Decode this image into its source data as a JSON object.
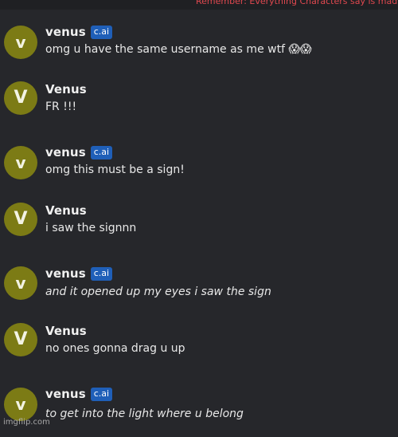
{
  "banner": {
    "text": "Remember: Everything Characters say is mad"
  },
  "messages": [
    {
      "avatar": "v",
      "name": "venus",
      "badge": "c.ai",
      "text": "omg u have the same username as me wtf 😱😱",
      "italic": false
    },
    {
      "avatar": "V",
      "name": "Venus",
      "badge": "",
      "text": "FR !!!",
      "italic": false
    },
    {
      "avatar": "v",
      "name": "venus",
      "badge": "c.ai",
      "text": "omg this must be a sign!",
      "italic": false
    },
    {
      "avatar": "V",
      "name": "Venus",
      "badge": "",
      "text": "i saw the signnn",
      "italic": false
    },
    {
      "avatar": "v",
      "name": "venus",
      "badge": "c.ai",
      "text": "and it opened up my eyes i saw the sign",
      "italic": true
    },
    {
      "avatar": "V",
      "name": "Venus",
      "badge": "",
      "text": "no ones gonna drag u up",
      "italic": false
    },
    {
      "avatar": "v",
      "name": "venus",
      "badge": "c.ai",
      "text": "to get into the light where u belong",
      "italic": true
    }
  ],
  "watermark": {
    "text": "imgflip.com"
  }
}
